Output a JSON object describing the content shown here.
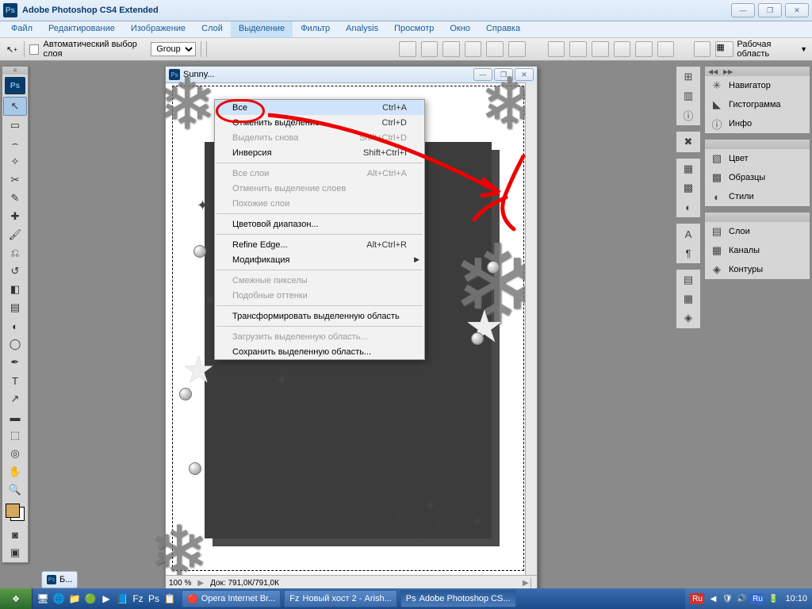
{
  "title": "Adobe Photoshop CS4 Extended",
  "menu": {
    "items": [
      "Файл",
      "Редактирование",
      "Изображение",
      "Слой",
      "Выделение",
      "Фильтр",
      "Analysis",
      "Просмотр",
      "Окно",
      "Справка"
    ],
    "activeIndex": 4
  },
  "options": {
    "autoSelectLabel": "Автоматический выбор слоя",
    "groupSelect": "Group",
    "workspaceLabel": "Рабочая область"
  },
  "dropdown": [
    {
      "label": "Все",
      "shortcut": "Ctrl+A",
      "hl": true
    },
    {
      "label": "Отменить выделение",
      "shortcut": "Ctrl+D"
    },
    {
      "label": "Выделить снова",
      "shortcut": "Shift+Ctrl+D",
      "disabled": true
    },
    {
      "label": "Инверсия",
      "shortcut": "Shift+Ctrl+I"
    },
    {
      "sep": true
    },
    {
      "label": "Все слои",
      "shortcut": "Alt+Ctrl+A",
      "disabled": true
    },
    {
      "label": "Отменить выделение слоев",
      "disabled": true
    },
    {
      "label": "Похожие слои",
      "disabled": true
    },
    {
      "sep": true
    },
    {
      "label": "Цветовой диапазон..."
    },
    {
      "sep": true
    },
    {
      "label": "Refine Edge...",
      "shortcut": "Alt+Ctrl+R"
    },
    {
      "label": "Модификация",
      "submenu": true
    },
    {
      "sep": true
    },
    {
      "label": "Смежные пикселы",
      "disabled": true
    },
    {
      "label": "Подобные оттенки",
      "disabled": true
    },
    {
      "sep": true
    },
    {
      "label": "Трансформировать выделенную область"
    },
    {
      "sep": true
    },
    {
      "label": "Загрузить выделенную область...",
      "disabled": true
    },
    {
      "label": "Сохранить выделенную область..."
    }
  ],
  "document": {
    "title": "Sunny...",
    "zoom": "100 %",
    "info": "Док: 791,0К/791,0К",
    "tabLabel": "Б..."
  },
  "panels": {
    "g1": [
      "Навигатор",
      "Гистограмма",
      "Инфо"
    ],
    "g2": [
      "Цвет",
      "Образцы",
      "Стили"
    ],
    "g3": [
      "Слои",
      "Каналы",
      "Контуры"
    ]
  },
  "taskbar": {
    "items": [
      {
        "icon": "🔴",
        "label": "Opera Internet Br..."
      },
      {
        "icon": "Fz",
        "label": "Новый хост 2 - Arish..."
      },
      {
        "icon": "Ps",
        "label": "Adobe Photoshop CS...",
        "active": true
      }
    ],
    "clock": "10:10",
    "lang": "Ru"
  }
}
